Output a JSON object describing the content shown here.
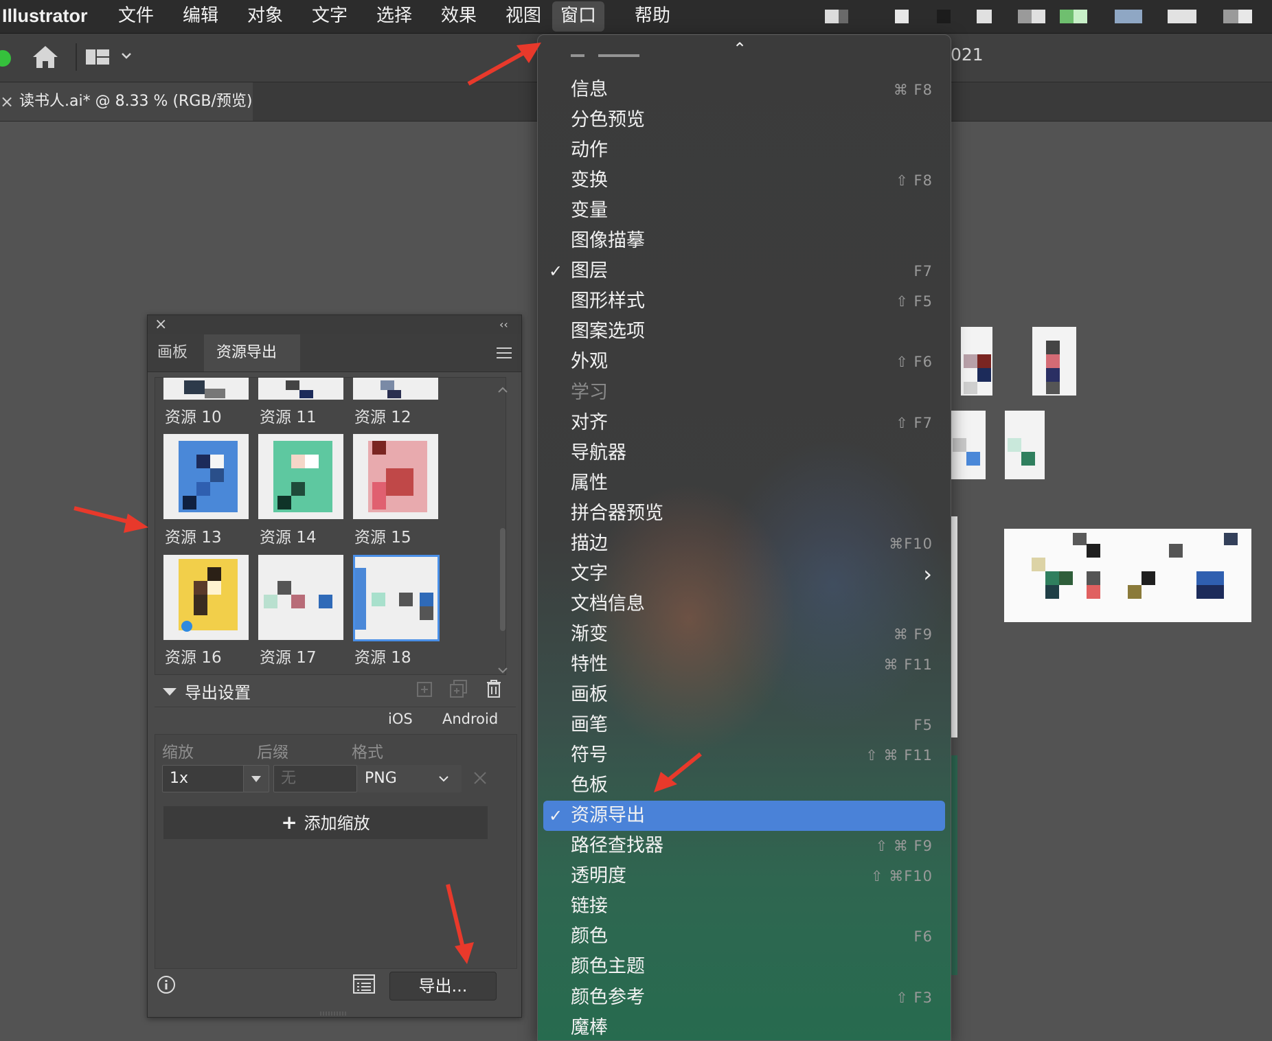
{
  "menubar": {
    "app_name": "Illustrator",
    "items": [
      "文件",
      "编辑",
      "对象",
      "文字",
      "选择",
      "效果",
      "视图",
      "窗口",
      "帮助"
    ],
    "active_item": "窗口"
  },
  "toolbar": {
    "home_icon": "home-icon",
    "workspace_icon": "workspace-switcher-icon",
    "partial_title_right": "021"
  },
  "document_tab": {
    "close_glyph": "×",
    "title": "读书人.ai* @ 8.33 % (RGB/预览)"
  },
  "panel": {
    "close_glyph": "×",
    "collapse_glyph": "‹‹",
    "tabs": [
      {
        "label": "画板",
        "active": false
      },
      {
        "label": "资源导出",
        "active": true
      }
    ],
    "assets": [
      {
        "label": "资源 10"
      },
      {
        "label": "资源 11"
      },
      {
        "label": "资源 12"
      },
      {
        "label": "资源 13"
      },
      {
        "label": "资源 14"
      },
      {
        "label": "资源 15"
      },
      {
        "label": "资源 16"
      },
      {
        "label": "资源 17"
      },
      {
        "label": "资源 18",
        "selected": true
      }
    ],
    "export_settings": {
      "title": "导出设置",
      "platforms": [
        "iOS",
        "Android"
      ],
      "columns": {
        "scale": "缩放",
        "suffix": "后缀",
        "format": "格式"
      },
      "scale_value": "1x",
      "suffix_placeholder": "无",
      "format_value": "PNG",
      "add_scale_label": "添加缩放"
    },
    "export_button": "导出..."
  },
  "window_menu": {
    "top_scroll_glyph": "⌃",
    "items": [
      {
        "label": "信息",
        "shortcut": "⌘ F8"
      },
      {
        "label": "分色预览",
        "shortcut": ""
      },
      {
        "label": "动作",
        "shortcut": ""
      },
      {
        "label": "变换",
        "shortcut": "⇧ F8"
      },
      {
        "label": "变量",
        "shortcut": ""
      },
      {
        "label": "图像描摹",
        "shortcut": ""
      },
      {
        "label": "图层",
        "shortcut": "F7",
        "checked": true
      },
      {
        "label": "图形样式",
        "shortcut": "⇧ F5"
      },
      {
        "label": "图案选项",
        "shortcut": ""
      },
      {
        "label": "外观",
        "shortcut": "⇧ F6"
      },
      {
        "label": "学习",
        "shortcut": "",
        "disabled": true
      },
      {
        "label": "对齐",
        "shortcut": "⇧ F7"
      },
      {
        "label": "导航器",
        "shortcut": ""
      },
      {
        "label": "属性",
        "shortcut": ""
      },
      {
        "label": "拼合器预览",
        "shortcut": ""
      },
      {
        "label": "描边",
        "shortcut": "⌘F10"
      },
      {
        "label": "文字",
        "shortcut": "›",
        "submenu": true
      },
      {
        "label": "文档信息",
        "shortcut": ""
      },
      {
        "label": "渐变",
        "shortcut": "⌘ F9"
      },
      {
        "label": "特性",
        "shortcut": "⌘ F11"
      },
      {
        "label": "画板",
        "shortcut": ""
      },
      {
        "label": "画笔",
        "shortcut": "F5"
      },
      {
        "label": "符号",
        "shortcut": "⇧ ⌘ F11"
      },
      {
        "label": "色板",
        "shortcut": ""
      },
      {
        "label": "资源导出",
        "shortcut": "",
        "checked": true,
        "highlighted": true
      },
      {
        "label": "路径查找器",
        "shortcut": "⇧ ⌘ F9"
      },
      {
        "label": "透明度",
        "shortcut": "⇧ ⌘F10"
      },
      {
        "label": "链接",
        "shortcut": ""
      },
      {
        "label": "颜色",
        "shortcut": "F6"
      },
      {
        "label": "颜色主题",
        "shortcut": ""
      },
      {
        "label": "颜色参考",
        "shortcut": "⇧ F3"
      },
      {
        "label": "魔棒",
        "shortcut": ""
      }
    ]
  },
  "colors": {
    "accent_highlight": "#4a82d8",
    "annotation_arrow": "#e8392b",
    "traffic_green": "#35c13c"
  }
}
